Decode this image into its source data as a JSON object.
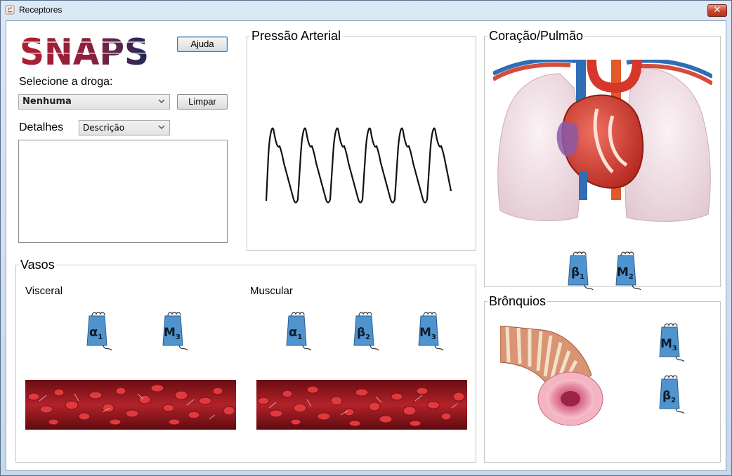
{
  "window": {
    "title": "Receptores",
    "close_glyph": "✕"
  },
  "logo": {
    "text": "SNAPS"
  },
  "buttons": {
    "help": "Ajuda",
    "clear": "Limpar"
  },
  "drug": {
    "label": "Selecione a droga:",
    "selected": "Nenhuma"
  },
  "details": {
    "label": "Detalhes",
    "selected": "Descrição",
    "text": ""
  },
  "panels": {
    "pressure": "Pressão Arterial",
    "heart": "Coração/Pulmão",
    "vessels": "Vasos",
    "bronchi": "Brônquios"
  },
  "vessels": {
    "visceral": "Visceral",
    "muscular": "Muscular"
  },
  "receptors": {
    "alpha1": {
      "symbol": "α",
      "sub": "1"
    },
    "beta1": {
      "symbol": "β",
      "sub": "1"
    },
    "beta2": {
      "symbol": "β",
      "sub": "2"
    },
    "m2": {
      "symbol": "M",
      "sub": "2"
    },
    "m3": {
      "symbol": "M",
      "sub": "3"
    }
  },
  "colors": {
    "receptor_fill": "#4f94cf",
    "blood": "#9c1a1f",
    "logo_red": "#b01f2e",
    "logo_navy": "#1d2a5a"
  }
}
